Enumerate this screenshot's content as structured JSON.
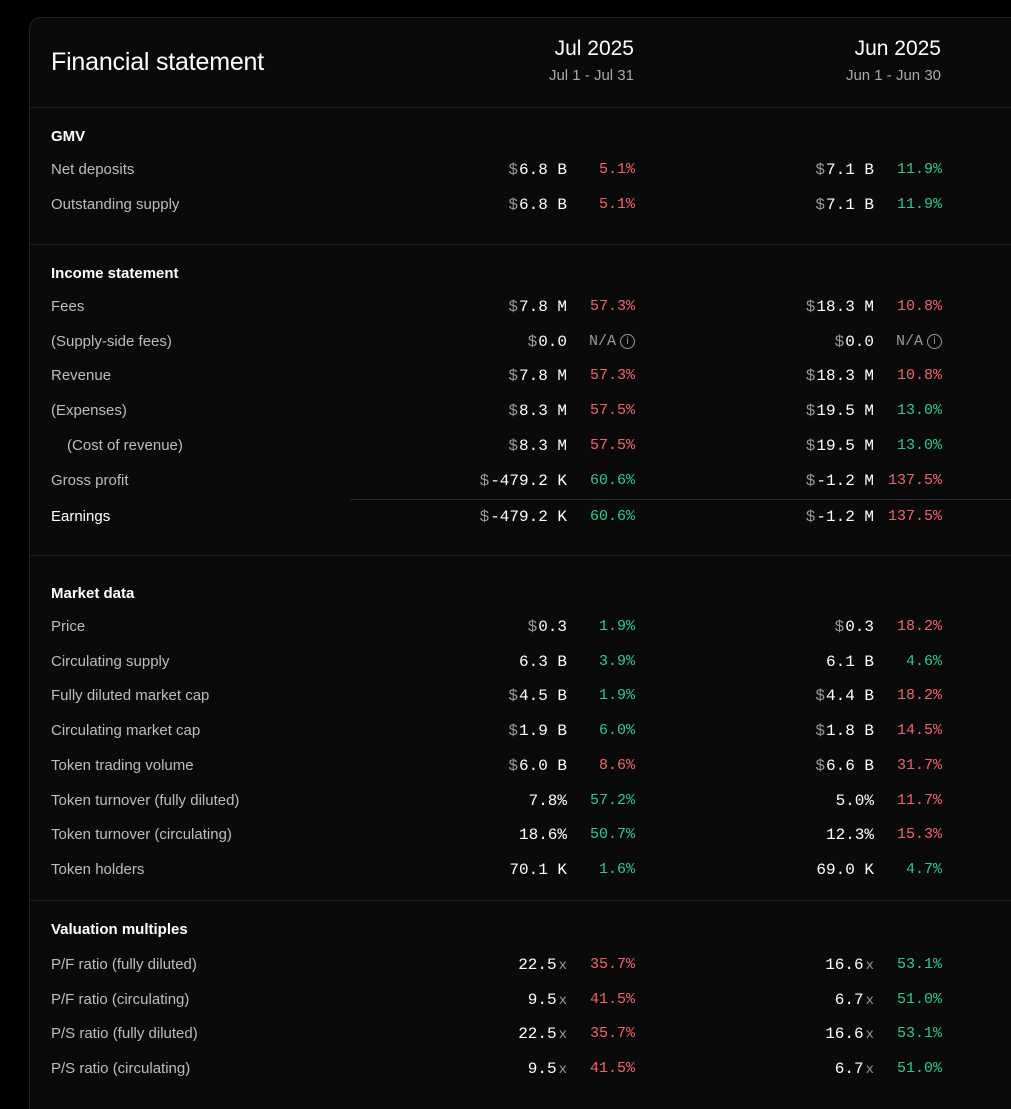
{
  "header": {
    "title": "Financial statement",
    "periods": [
      {
        "name": "Jul 2025",
        "range": "Jul 1 - Jul 31"
      },
      {
        "name": "Jun 2025",
        "range": "Jun 1 - Jun 30"
      }
    ]
  },
  "colors": {
    "positive": "#34c98a",
    "negative": "#f0656a"
  },
  "sections": [
    {
      "title": "GMV",
      "rows": [
        {
          "label": "Net deposits",
          "cells": [
            {
              "cur": "$",
              "num": "6.8 B",
              "suf": "",
              "chg": "5.1%",
              "dir": "neg"
            },
            {
              "cur": "$",
              "num": "7.1 B",
              "suf": "",
              "chg": "11.9%",
              "dir": "pos"
            }
          ]
        },
        {
          "label": "Outstanding supply",
          "cells": [
            {
              "cur": "$",
              "num": "6.8 B",
              "suf": "",
              "chg": "5.1%",
              "dir": "neg"
            },
            {
              "cur": "$",
              "num": "7.1 B",
              "suf": "",
              "chg": "11.9%",
              "dir": "pos"
            }
          ]
        }
      ]
    },
    {
      "title": "Income statement",
      "rows": [
        {
          "label": "Fees",
          "cells": [
            {
              "cur": "$",
              "num": "7.8 M",
              "suf": "",
              "chg": "57.3%",
              "dir": "neg"
            },
            {
              "cur": "$",
              "num": "18.3 M",
              "suf": "",
              "chg": "10.8%",
              "dir": "neg"
            }
          ]
        },
        {
          "label": "(Supply-side fees)",
          "cells": [
            {
              "cur": "$",
              "num": "0.0",
              "suf": "",
              "chg": "N/A",
              "dir": "na",
              "info": "i"
            },
            {
              "cur": "$",
              "num": "0.0",
              "suf": "",
              "chg": "N/A",
              "dir": "na",
              "info": "i"
            }
          ]
        },
        {
          "label": "Revenue",
          "cells": [
            {
              "cur": "$",
              "num": "7.8 M",
              "suf": "",
              "chg": "57.3%",
              "dir": "neg"
            },
            {
              "cur": "$",
              "num": "18.3 M",
              "suf": "",
              "chg": "10.8%",
              "dir": "neg"
            }
          ]
        },
        {
          "label": "(Expenses)",
          "cells": [
            {
              "cur": "$",
              "num": "8.3 M",
              "suf": "",
              "chg": "57.5%",
              "dir": "neg"
            },
            {
              "cur": "$",
              "num": "19.5 M",
              "suf": "",
              "chg": "13.0%",
              "dir": "pos"
            }
          ]
        },
        {
          "label": "(Cost of revenue)",
          "cells": [
            {
              "cur": "$",
              "num": "8.3 M",
              "suf": "",
              "chg": "57.5%",
              "dir": "neg"
            },
            {
              "cur": "$",
              "num": "19.5 M",
              "suf": "",
              "chg": "13.0%",
              "dir": "pos"
            }
          ]
        },
        {
          "label": "Gross profit",
          "cells": [
            {
              "cur": "$",
              "num": "-479.2 K",
              "suf": "",
              "chg": "60.6%",
              "dir": "pos"
            },
            {
              "cur": "$",
              "num": "-1.2 M",
              "suf": "",
              "chg": "137.5%",
              "dir": "neg"
            }
          ]
        },
        {
          "label": "Earnings",
          "cells": [
            {
              "cur": "$",
              "num": "-479.2 K",
              "suf": "",
              "chg": "60.6%",
              "dir": "pos"
            },
            {
              "cur": "$",
              "num": "-1.2 M",
              "suf": "",
              "chg": "137.5%",
              "dir": "neg"
            }
          ]
        }
      ]
    },
    {
      "title": "Market data",
      "rows": [
        {
          "label": "Price",
          "cells": [
            {
              "cur": "$",
              "num": "0.3",
              "suf": "",
              "chg": "1.9%",
              "dir": "pos"
            },
            {
              "cur": "$",
              "num": "0.3",
              "suf": "",
              "chg": "18.2%",
              "dir": "neg"
            }
          ]
        },
        {
          "label": "Circulating supply",
          "cells": [
            {
              "cur": "",
              "num": "6.3 B",
              "suf": "",
              "chg": "3.9%",
              "dir": "pos"
            },
            {
              "cur": "",
              "num": "6.1 B",
              "suf": "",
              "chg": "4.6%",
              "dir": "pos"
            }
          ]
        },
        {
          "label": "Fully diluted market cap",
          "cells": [
            {
              "cur": "$",
              "num": "4.5 B",
              "suf": "",
              "chg": "1.9%",
              "dir": "pos"
            },
            {
              "cur": "$",
              "num": "4.4 B",
              "suf": "",
              "chg": "18.2%",
              "dir": "neg"
            }
          ]
        },
        {
          "label": "Circulating market cap",
          "cells": [
            {
              "cur": "$",
              "num": "1.9 B",
              "suf": "",
              "chg": "6.0%",
              "dir": "pos"
            },
            {
              "cur": "$",
              "num": "1.8 B",
              "suf": "",
              "chg": "14.5%",
              "dir": "neg"
            }
          ]
        },
        {
          "label": "Token trading volume",
          "cells": [
            {
              "cur": "$",
              "num": "6.0 B",
              "suf": "",
              "chg": "8.6%",
              "dir": "neg"
            },
            {
              "cur": "$",
              "num": "6.6 B",
              "suf": "",
              "chg": "31.7%",
              "dir": "neg"
            }
          ]
        },
        {
          "label": "Token turnover (fully diluted)",
          "cells": [
            {
              "cur": "",
              "num": "7.8%",
              "suf": "",
              "chg": "57.2%",
              "dir": "pos"
            },
            {
              "cur": "",
              "num": "5.0%",
              "suf": "",
              "chg": "11.7%",
              "dir": "neg"
            }
          ]
        },
        {
          "label": "Token turnover (circulating)",
          "cells": [
            {
              "cur": "",
              "num": "18.6%",
              "suf": "",
              "chg": "50.7%",
              "dir": "pos"
            },
            {
              "cur": "",
              "num": "12.3%",
              "suf": "",
              "chg": "15.3%",
              "dir": "neg"
            }
          ]
        },
        {
          "label": "Token holders",
          "cells": [
            {
              "cur": "",
              "num": "70.1 K",
              "suf": "",
              "chg": "1.6%",
              "dir": "pos"
            },
            {
              "cur": "",
              "num": "69.0 K",
              "suf": "",
              "chg": "4.7%",
              "dir": "pos"
            }
          ]
        }
      ]
    },
    {
      "title": "Valuation multiples",
      "rows": [
        {
          "label": "P/F ratio (fully diluted)",
          "cells": [
            {
              "cur": "",
              "num": "22.5",
              "suf": "x",
              "chg": "35.7%",
              "dir": "neg"
            },
            {
              "cur": "",
              "num": "16.6",
              "suf": "x",
              "chg": "53.1%",
              "dir": "pos"
            }
          ]
        },
        {
          "label": "P/F ratio (circulating)",
          "cells": [
            {
              "cur": "",
              "num": "9.5",
              "suf": "x",
              "chg": "41.5%",
              "dir": "neg"
            },
            {
              "cur": "",
              "num": "6.7",
              "suf": "x",
              "chg": "51.0%",
              "dir": "pos"
            }
          ]
        },
        {
          "label": "P/S ratio (fully diluted)",
          "cells": [
            {
              "cur": "",
              "num": "22.5",
              "suf": "x",
              "chg": "35.7%",
              "dir": "neg"
            },
            {
              "cur": "",
              "num": "16.6",
              "suf": "x",
              "chg": "53.1%",
              "dir": "pos"
            }
          ]
        },
        {
          "label": "P/S ratio (circulating)",
          "cells": [
            {
              "cur": "",
              "num": "9.5",
              "suf": "x",
              "chg": "41.5%",
              "dir": "neg"
            },
            {
              "cur": "",
              "num": "6.7",
              "suf": "x",
              "chg": "51.0%",
              "dir": "pos"
            }
          ]
        }
      ]
    }
  ]
}
